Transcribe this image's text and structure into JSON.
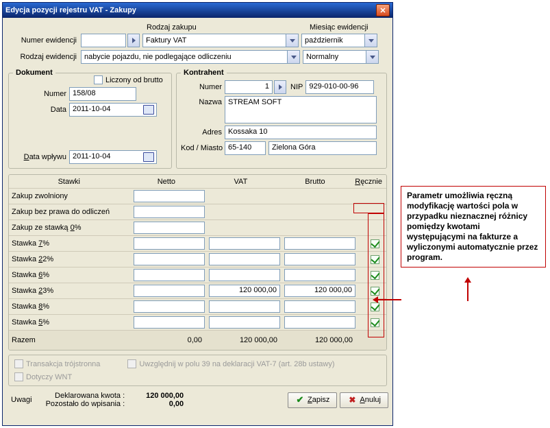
{
  "title": "Edycja pozycji rejestru VAT - Zakupy",
  "top": {
    "rodzaj_zakupu_header": "Rodzaj zakupu",
    "miesiac_ewidencji_header": "Miesiąc ewidencji",
    "numer_ewidencji_label": "Numer ewidencji",
    "numer_ewidencji_value": "",
    "rodzaj_ewidencji_label": "Rodzaj ewidencji",
    "faktura_type": "Faktury VAT",
    "month": "październik",
    "rodzaj_ewidencji_value": "nabycie pojazdu, nie podlegające odliczeniu",
    "normalny": "Normalny"
  },
  "dokument": {
    "title": "Dokument",
    "liczony_label": "Liczony od brutto",
    "numer_label": "Numer",
    "numer_value": "158/08",
    "data_label": "Data",
    "data_value": "2011-10-04",
    "data_wplywu_label": "Data wpływu",
    "data_wplywu_value": "2011-10-04"
  },
  "kontrahent": {
    "title": "Kontrahent",
    "numer_label": "Numer",
    "numer_value": "1",
    "nip_label": "NIP",
    "nip_value": "929-010-00-96",
    "nazwa_label": "Nazwa",
    "nazwa_value": "STREAM SOFT",
    "adres_label": "Adres",
    "adres_value": "Kossaka 10",
    "kodmiasto_label": "Kod / Miasto",
    "kod_value": "65-140",
    "miasto_value": "Zielona Góra"
  },
  "grid": {
    "hdr_stawki": "Stawki",
    "hdr_netto": "Netto",
    "hdr_vat": "VAT",
    "hdr_brutto": "Brutto",
    "hdr_recznie": "Ręcznie",
    "rows": [
      {
        "label": "Zakup zwolniony",
        "netto": "",
        "vat": "",
        "brutto": "",
        "has_inputs": "n",
        "chk": false
      },
      {
        "label": "Zakup bez prawa do odliczeń",
        "netto": "",
        "vat": "",
        "brutto": "",
        "has_inputs": "n0",
        "chk": false
      },
      {
        "label": "Zakup ze stawką 0%",
        "u": "0",
        "netto": "",
        "vat": "",
        "brutto": "",
        "has_inputs": "n0",
        "chk": false
      },
      {
        "label": "Stawka 7%",
        "u": "7",
        "netto": "",
        "vat": "",
        "brutto": "",
        "has_inputs": "nvb",
        "chk": true
      },
      {
        "label": "Stawka 22%",
        "u": "2",
        "netto": "",
        "vat": "",
        "brutto": "",
        "has_inputs": "nvb",
        "chk": true
      },
      {
        "label": "Stawka 6%",
        "u": "6",
        "netto": "",
        "vat": "",
        "brutto": "",
        "has_inputs": "nvb",
        "chk": true
      },
      {
        "label": "Stawka 23%",
        "u": "2",
        "netto": "",
        "vat": "120 000,00",
        "brutto": "120 000,00",
        "has_inputs": "nvb",
        "chk": true
      },
      {
        "label": "Stawka 8%",
        "u": "8",
        "netto": "",
        "vat": "",
        "brutto": "",
        "has_inputs": "nvb",
        "chk": true
      },
      {
        "label": "Stawka 5%",
        "u": "5",
        "netto": "",
        "vat": "",
        "brutto": "",
        "has_inputs": "nvb",
        "chk": true
      }
    ],
    "sum_label": "Razem",
    "sum_netto": "0,00",
    "sum_vat": "120 000,00",
    "sum_brutto": "120 000,00"
  },
  "bottom": {
    "trans_troj": "Transakcja trójstronna",
    "uwzgl39": "Uwzględnij w polu 39 na deklaracji VAT-7 (art. 28b ustawy)",
    "dotyczy_wnt": "Dotyczy WNT"
  },
  "footer": {
    "uwagi_label": "Uwagi",
    "dekl_label": "Deklarowana kwota :",
    "dekl_value": "120 000,00",
    "pozostalo_label": "Pozostało do wpisania :",
    "pozostalo_value": "0,00",
    "zapisz": "Zapisz",
    "anuluj": "Anuluj"
  },
  "callout": "Parametr umożliwia ręczną modyfikację wartości pola w przypadku nieznacznej różnicy pomiędzy kwotami występującymi na fakturze a wyliczonymi automatycznie przez program."
}
